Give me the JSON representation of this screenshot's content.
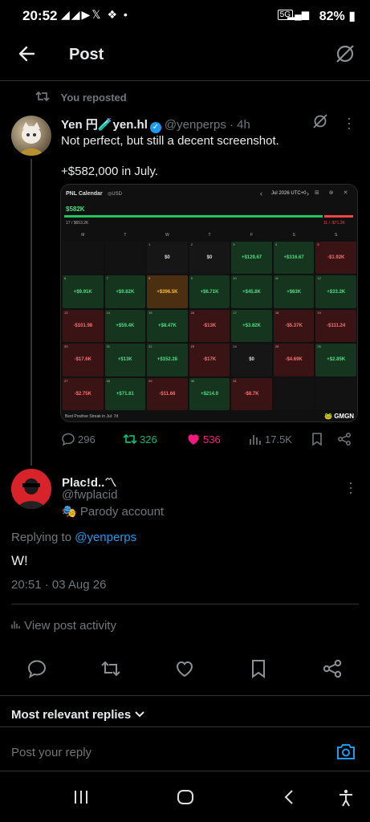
{
  "status_bar": {
    "time": "20:52",
    "left_icons": "◢◢▶𝕏 ❖ •",
    "network": "5G",
    "battery": "82%"
  },
  "header": {
    "title": "Post"
  },
  "repost_indicator": {
    "label": "You reposted"
  },
  "post": {
    "display_name": "Yen 円",
    "emoji": "🧪",
    "display_name_suffix": "yen.hl",
    "handle": "@yenperps",
    "time": "· 4h",
    "text_line1": "Not perfect, but still a decent screenshot.",
    "text_line2": "+$582,000 in July.",
    "metrics": {
      "replies": "296",
      "reposts": "326",
      "likes": "536",
      "views": "17.5K"
    }
  },
  "pnl_card": {
    "title": "PNL Calendar",
    "currency": "◎USD",
    "month": "Jul 2026 UTC+0",
    "tools": "⊞ ⊗ ✕",
    "total": "$582K",
    "wins": "17 / $653.2K",
    "losses": "11 / -$71.3K",
    "weekdays": [
      "M",
      "T",
      "W",
      "T",
      "F",
      "S",
      "S"
    ],
    "cells": [
      {
        "d": "",
        "v": "",
        "t": "empty"
      },
      {
        "d": "",
        "v": "",
        "t": "empty"
      },
      {
        "d": "1",
        "v": "$0",
        "t": "neu"
      },
      {
        "d": "2",
        "v": "$0",
        "t": "neu"
      },
      {
        "d": "3",
        "v": "+$129.67",
        "t": "pos"
      },
      {
        "d": "4",
        "v": "+$316.67",
        "t": "pos"
      },
      {
        "d": "5",
        "v": "-$1.92K",
        "t": "neg"
      },
      {
        "d": "6",
        "v": "+$9.91K",
        "t": "pos"
      },
      {
        "d": "7",
        "v": "+$9.82K",
        "t": "pos"
      },
      {
        "d": "8",
        "v": "+$396.5K",
        "t": "hl"
      },
      {
        "d": "9",
        "v": "+$6.71K",
        "t": "pos"
      },
      {
        "d": "10",
        "v": "+$45.8K",
        "t": "pos"
      },
      {
        "d": "11",
        "v": "+$63K",
        "t": "pos"
      },
      {
        "d": "12",
        "v": "+$33.2K",
        "t": "pos"
      },
      {
        "d": "13",
        "v": "-$101.98",
        "t": "neg"
      },
      {
        "d": "14",
        "v": "+$59.4K",
        "t": "pos"
      },
      {
        "d": "15",
        "v": "+$8.47K",
        "t": "pos"
      },
      {
        "d": "16",
        "v": "-$13K",
        "t": "neg"
      },
      {
        "d": "17",
        "v": "+$3.82K",
        "t": "pos"
      },
      {
        "d": "18",
        "v": "-$5.37K",
        "t": "neg"
      },
      {
        "d": "19",
        "v": "-$111.24",
        "t": "neg"
      },
      {
        "d": "20",
        "v": "-$17.6K",
        "t": "neg"
      },
      {
        "d": "21",
        "v": "+$13K",
        "t": "pos"
      },
      {
        "d": "22",
        "v": "+$152.28",
        "t": "pos"
      },
      {
        "d": "23",
        "v": "-$17K",
        "t": "neg"
      },
      {
        "d": "24",
        "v": "$0",
        "t": "neu"
      },
      {
        "d": "25",
        "v": "-$4.69K",
        "t": "neg"
      },
      {
        "d": "26",
        "v": "+$2.85K",
        "t": "pos"
      },
      {
        "d": "27",
        "v": "-$2.75K",
        "t": "neg"
      },
      {
        "d": "28",
        "v": "+$71.81",
        "t": "pos"
      },
      {
        "d": "29",
        "v": "-$11.66",
        "t": "neg"
      },
      {
        "d": "30",
        "v": "+$214.9",
        "t": "pos"
      },
      {
        "d": "31",
        "v": "-$8.7K",
        "t": "neg"
      },
      {
        "d": "",
        "v": "",
        "t": "empty"
      },
      {
        "d": "",
        "v": "",
        "t": "empty"
      }
    ],
    "streak": "Best Positive Streak in Jul: 7d",
    "brand": "GMGN"
  },
  "reply": {
    "display_name": "Plac!d..〽",
    "handle": "@fwplacid",
    "parody_label": "🎭 Parody account",
    "replying_to_label": "Replying to",
    "replying_to_handle": "@yenperps",
    "text": "W!",
    "timestamp": "20:51 · 03 Aug 26"
  },
  "view_activity": "View post activity",
  "sort_label": "Most relevant replies",
  "reply_input": {
    "placeholder": "Post your reply"
  },
  "colors": {
    "accent": "#1d9bf0",
    "like": "#f91880",
    "repost": "#00ba7c",
    "muted": "#71767b"
  }
}
